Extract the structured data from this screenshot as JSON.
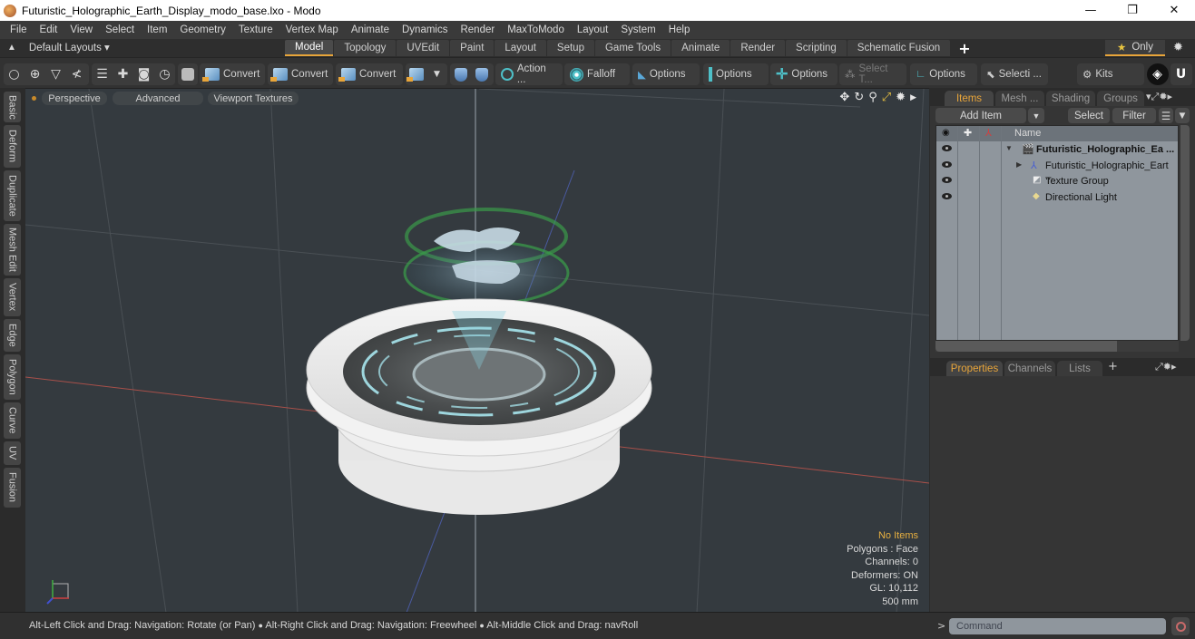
{
  "window": {
    "title": "Futuristic_Holographic_Earth_Display_modo_base.lxo - Modo",
    "minimize": "—",
    "restore": "❐",
    "close": "✕"
  },
  "menu": [
    "File",
    "Edit",
    "View",
    "Select",
    "Item",
    "Geometry",
    "Texture",
    "Vertex Map",
    "Animate",
    "Dynamics",
    "Render",
    "MaxToModo",
    "Layout",
    "System",
    "Help"
  ],
  "layoutbar": {
    "layouts_label": "Default Layouts ▾",
    "tabs": [
      "Model",
      "Topology",
      "UVEdit",
      "Paint",
      "Layout",
      "Setup",
      "Game Tools",
      "Animate",
      "Render",
      "Scripting",
      "Schematic Fusion"
    ],
    "active_tab": "Model",
    "add_tab": "+",
    "only_label": "Only",
    "star": "★"
  },
  "toolbar": {
    "convert1": "Convert",
    "convert2": "Convert",
    "convert3": "Convert",
    "action": "Action ...",
    "falloff": "Falloff",
    "options1": "Options",
    "options2": "Options",
    "options3": "Options",
    "select_t": "Select T...",
    "options4": "Options",
    "selecti": "Selecti ...",
    "kits": "Kits"
  },
  "left_tabs": [
    "Basic",
    "Deform",
    "Duplicate",
    "Mesh Edit",
    "Vertex",
    "Edge",
    "Polygon",
    "Curve",
    "UV",
    "Fusion"
  ],
  "viewport": {
    "perspective": "Perspective",
    "advanced": "Advanced",
    "viewport_textures": "Viewport Textures",
    "info": {
      "selection": "No Items",
      "polygons": "Polygons : Face",
      "channels": "Channels: 0",
      "deformers": "Deformers: ON",
      "gl": "GL: 10,112",
      "scale": "500 mm"
    }
  },
  "items_panel": {
    "tabs": [
      "Items",
      "Mesh ...",
      "Shading",
      "Groups"
    ],
    "active_tab": "Items",
    "add_item": "Add Item",
    "select": "Select",
    "filter": "Filter",
    "column_name": "Name",
    "rows": [
      {
        "name": "Futuristic_Holographic_Ea ...",
        "type": "scene",
        "bold": true
      },
      {
        "name": "Futuristic_Holographic_Eart ...",
        "type": "mesh-locator"
      },
      {
        "name": "Texture Group",
        "type": "texture-group"
      },
      {
        "name": "Directional Light",
        "type": "light"
      }
    ]
  },
  "properties_panel": {
    "tabs": [
      "Properties",
      "Channels",
      "Lists"
    ],
    "active_tab": "Properties",
    "add_tab": "+"
  },
  "status": {
    "hint_1": "Alt-Left Click and Drag: Navigation: Rotate (or Pan)",
    "hint_2": "Alt-Right Click and Drag: Navigation: Freewheel",
    "hint_3": "Alt-Middle Click and Drag: navRoll",
    "separator": "●"
  },
  "command": {
    "prompt": ">",
    "placeholder": "Command"
  },
  "colors": {
    "accent": "#e8a53a",
    "viewport_bg": "#343a3f",
    "list_bg": "#8f969d",
    "teal": "#4ec0c8"
  }
}
